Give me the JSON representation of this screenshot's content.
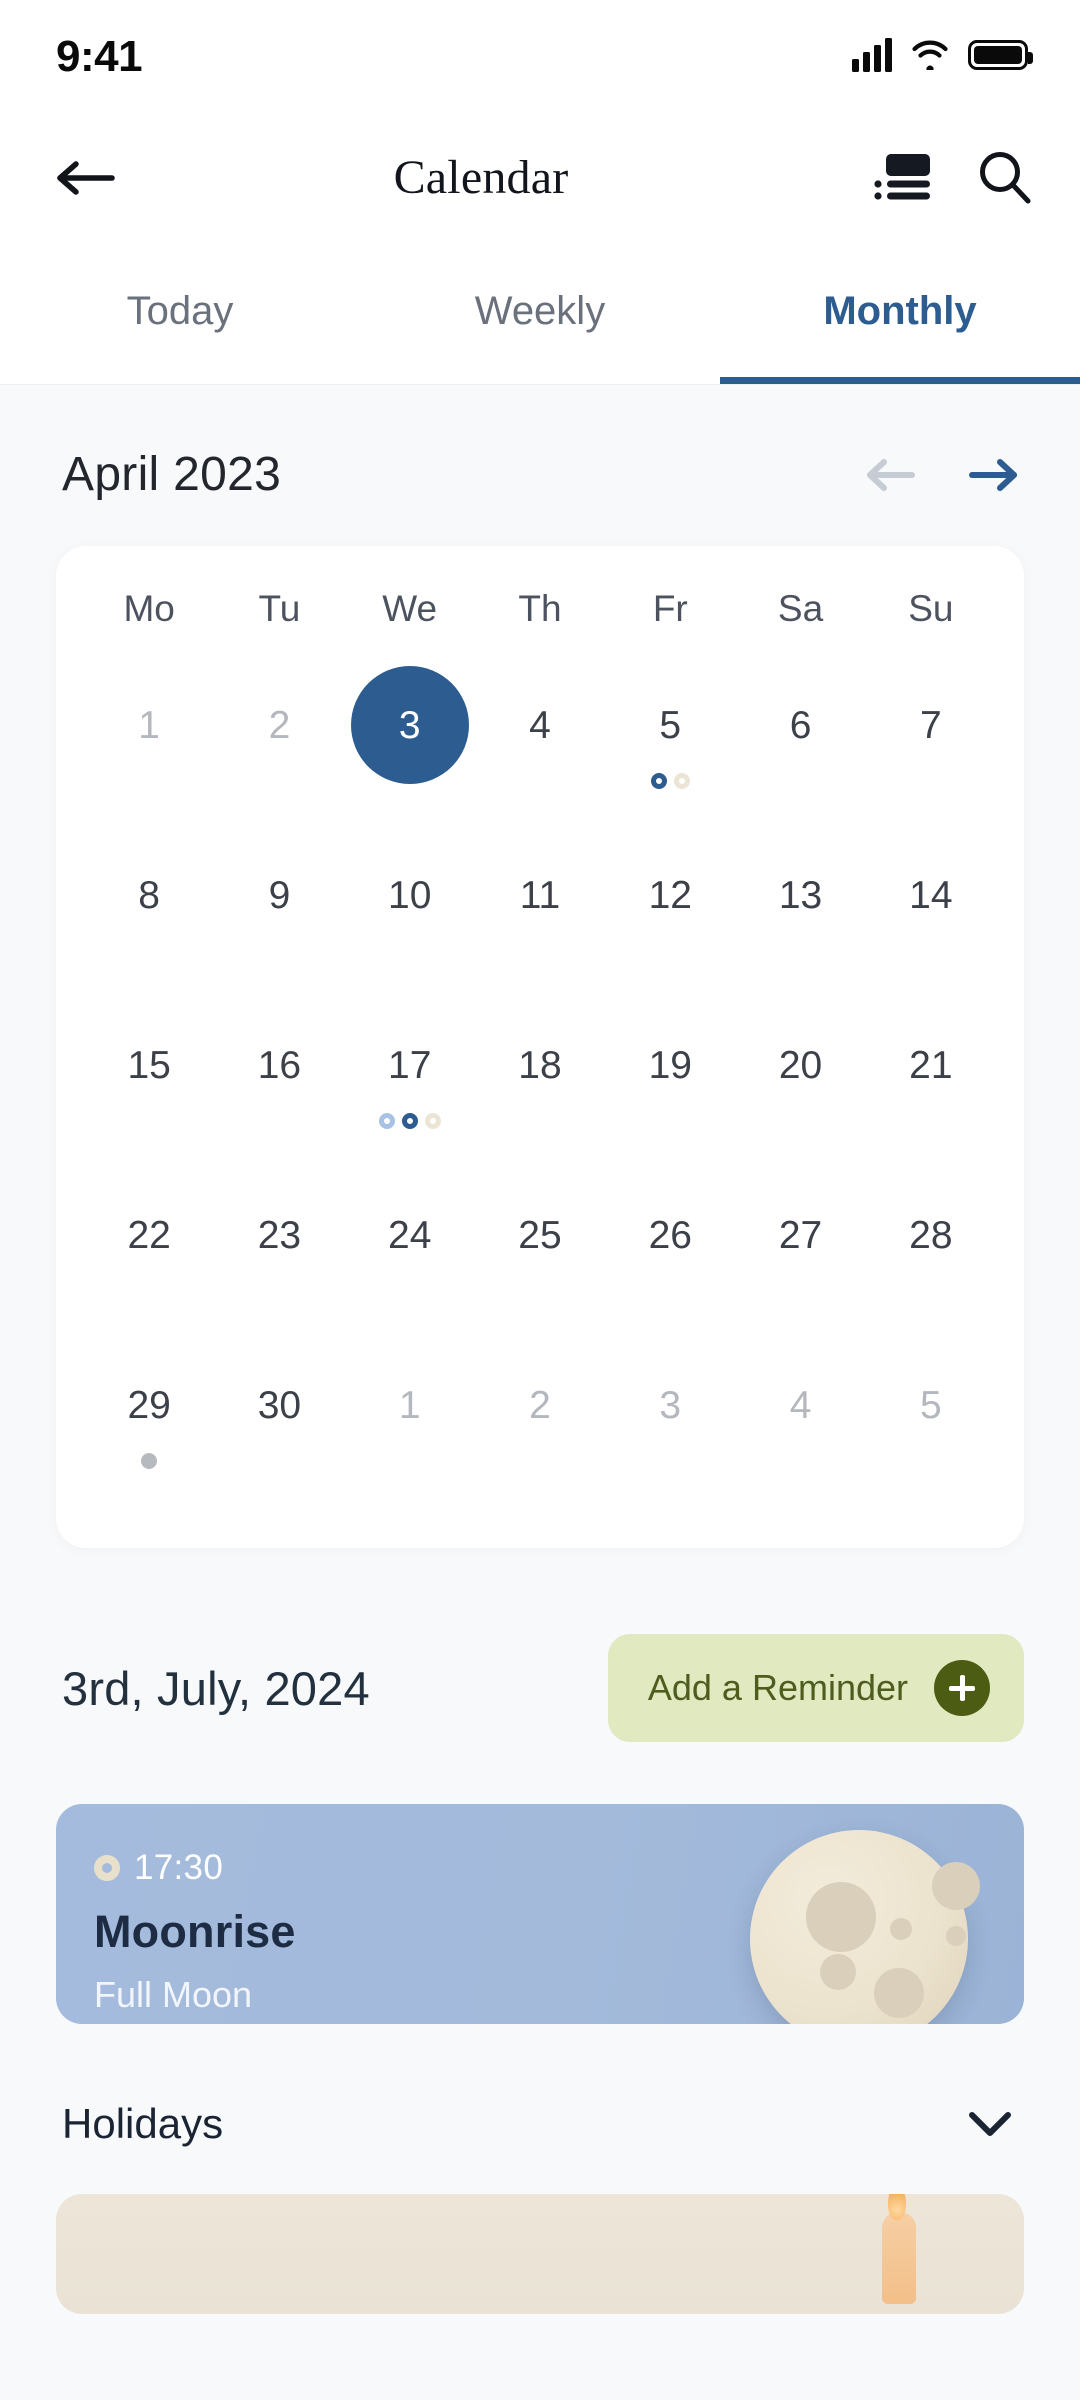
{
  "status_bar": {
    "time": "9:41",
    "signal_icon": "cellular-signal-icon",
    "wifi_icon": "wifi-icon",
    "battery_icon": "battery-full-icon"
  },
  "app_bar": {
    "back_icon": "back-arrow-icon",
    "title": "Calendar",
    "list_icon": "list-view-icon",
    "search_icon": "search-icon"
  },
  "tabs": [
    {
      "label": "Today",
      "active": false
    },
    {
      "label": "Weekly",
      "active": false
    },
    {
      "label": "Monthly",
      "active": true
    }
  ],
  "month_header": {
    "label": "April 2023",
    "prev_icon": "arrow-left-icon",
    "next_icon": "arrow-right-icon",
    "prev_color": "#c7ccd4",
    "next_color": "#2d5c91"
  },
  "calendar": {
    "weekdays": [
      "Mo",
      "Tu",
      "We",
      "Th",
      "Fr",
      "Sa",
      "Su"
    ],
    "weeks": [
      [
        {
          "day": "1",
          "muted": true,
          "selected": false,
          "dots": []
        },
        {
          "day": "2",
          "muted": true,
          "selected": false,
          "dots": []
        },
        {
          "day": "3",
          "muted": false,
          "selected": true,
          "dots": []
        },
        {
          "day": "4",
          "muted": false,
          "selected": false,
          "dots": []
        },
        {
          "day": "5",
          "muted": false,
          "selected": false,
          "dots": [
            "#2d5c91",
            "#ece5d6"
          ]
        },
        {
          "day": "6",
          "muted": false,
          "selected": false,
          "dots": []
        },
        {
          "day": "7",
          "muted": false,
          "selected": false,
          "dots": []
        }
      ],
      [
        {
          "day": "8",
          "muted": false,
          "selected": false,
          "dots": []
        },
        {
          "day": "9",
          "muted": false,
          "selected": false,
          "dots": []
        },
        {
          "day": "10",
          "muted": false,
          "selected": false,
          "dots": []
        },
        {
          "day": "11",
          "muted": false,
          "selected": false,
          "dots": []
        },
        {
          "day": "12",
          "muted": false,
          "selected": false,
          "dots": []
        },
        {
          "day": "13",
          "muted": false,
          "selected": false,
          "dots": []
        },
        {
          "day": "14",
          "muted": false,
          "selected": false,
          "dots": []
        }
      ],
      [
        {
          "day": "15",
          "muted": false,
          "selected": false,
          "dots": []
        },
        {
          "day": "16",
          "muted": false,
          "selected": false,
          "dots": []
        },
        {
          "day": "17",
          "muted": false,
          "selected": false,
          "dots": [
            "#a7c2e4",
            "#2d5c91",
            "#ece5d6"
          ]
        },
        {
          "day": "18",
          "muted": false,
          "selected": false,
          "dots": []
        },
        {
          "day": "19",
          "muted": false,
          "selected": false,
          "dots": []
        },
        {
          "day": "20",
          "muted": false,
          "selected": false,
          "dots": []
        },
        {
          "day": "21",
          "muted": false,
          "selected": false,
          "dots": []
        }
      ],
      [
        {
          "day": "22",
          "muted": false,
          "selected": false,
          "dots": []
        },
        {
          "day": "23",
          "muted": false,
          "selected": false,
          "dots": []
        },
        {
          "day": "24",
          "muted": false,
          "selected": false,
          "dots": []
        },
        {
          "day": "25",
          "muted": false,
          "selected": false,
          "dots": []
        },
        {
          "day": "26",
          "muted": false,
          "selected": false,
          "dots": []
        },
        {
          "day": "27",
          "muted": false,
          "selected": false,
          "dots": []
        },
        {
          "day": "28",
          "muted": false,
          "selected": false,
          "dots": []
        }
      ],
      [
        {
          "day": "29",
          "muted": false,
          "selected": false,
          "dots_solid": [
            "#b6b9bd"
          ]
        },
        {
          "day": "30",
          "muted": false,
          "selected": false,
          "dots": []
        },
        {
          "day": "1",
          "muted": true,
          "selected": false,
          "dots": []
        },
        {
          "day": "2",
          "muted": true,
          "selected": false,
          "dots": []
        },
        {
          "day": "3",
          "muted": true,
          "selected": false,
          "dots": []
        },
        {
          "day": "4",
          "muted": true,
          "selected": false,
          "dots": []
        },
        {
          "day": "5",
          "muted": true,
          "selected": false,
          "dots": []
        }
      ]
    ]
  },
  "detail": {
    "date_title": "3rd, July, 2024",
    "reminder_label": "Add a Reminder",
    "reminder_icon": "plus-icon"
  },
  "moon_event": {
    "time": "17:30",
    "time_icon": "clock-ring-icon",
    "title": "Moonrise",
    "subtitle": "Full Moon",
    "art_icon": "full-moon-icon"
  },
  "holidays": {
    "label": "Holidays",
    "chevron_icon": "chevron-down-icon"
  },
  "colors": {
    "accent": "#2d5c91",
    "page_bg": "#f7f9fb",
    "card_bg": "#ffffff",
    "moon_card_bg": "#a4bbdd",
    "reminder_bg": "#e0e9c0",
    "reminder_fg": "#4c5c12",
    "holiday_card_bg": "#ece5d8"
  }
}
